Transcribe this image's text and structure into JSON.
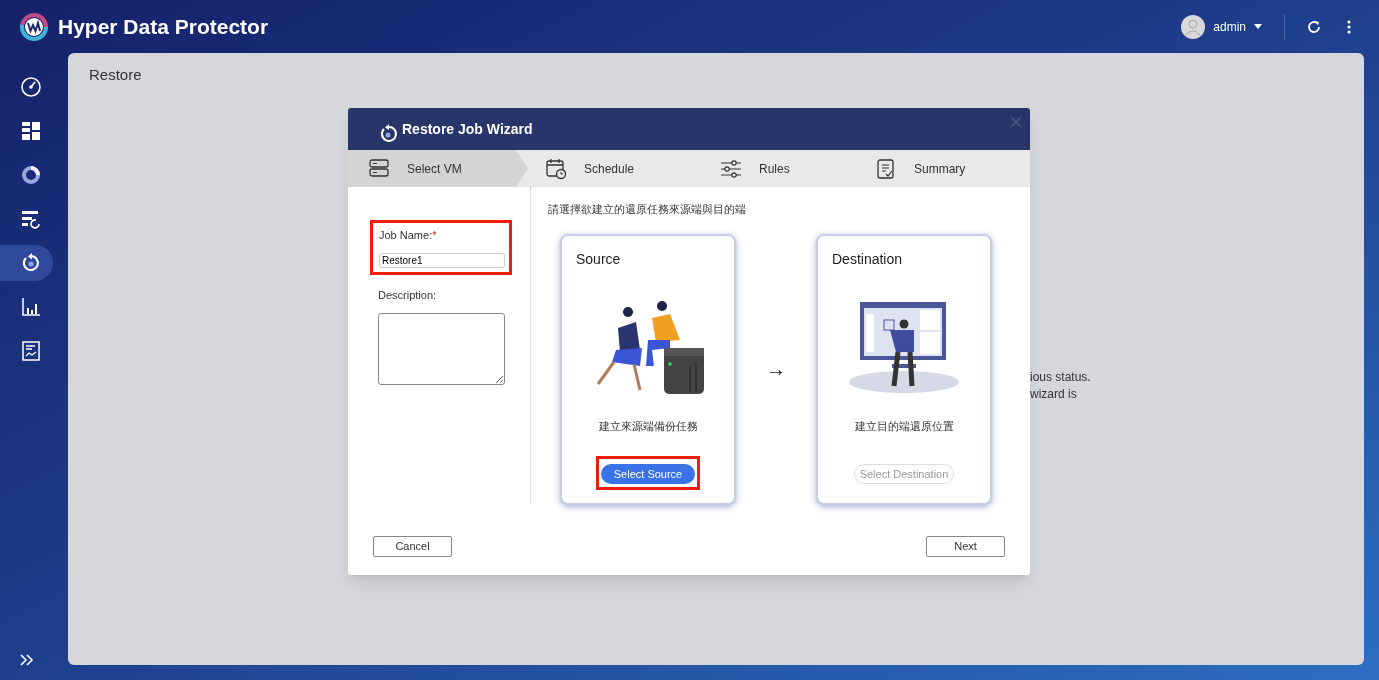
{
  "app": {
    "title": "Hyper Data Protector",
    "user": "admin"
  },
  "sidebar": {
    "items": [
      {
        "kind": "gauge",
        "selected": false
      },
      {
        "kind": "grid",
        "selected": false
      },
      {
        "kind": "donut",
        "selected": false
      },
      {
        "kind": "list-refresh",
        "selected": false
      },
      {
        "kind": "restore",
        "selected": true
      },
      {
        "kind": "chart",
        "selected": false
      },
      {
        "kind": "report",
        "selected": false
      }
    ]
  },
  "page": {
    "title": "Restore",
    "background_text": [
      "ious status.",
      "wizard is"
    ]
  },
  "dialog": {
    "title": "Restore Job Wizard",
    "steps": [
      {
        "kind": "vm",
        "label": "Select VM",
        "selected": true
      },
      {
        "kind": "schedule",
        "label": "Schedule",
        "selected": false
      },
      {
        "kind": "rules",
        "label": "Rules",
        "selected": false
      },
      {
        "kind": "summary",
        "label": "Summary",
        "selected": false
      }
    ],
    "job_name": {
      "label": "Job Name:",
      "required_mark": "*",
      "value": "Restore1",
      "highlighted": true
    },
    "description": {
      "label": "Description:"
    },
    "instruction": "請選擇欲建立的還原任務來源端與目的端",
    "cards": [
      {
        "kind": "source",
        "title": "Source",
        "caption": "建立來源端備份任務",
        "button": "Select Source",
        "disabled": false,
        "highlighted": true
      },
      {
        "kind": "destination",
        "title": "Destination",
        "caption": "建立目的端還原位置",
        "button": "Select Destination",
        "disabled": true,
        "highlighted": false
      }
    ],
    "arrow": "→",
    "buttons": [
      "Cancel",
      "Next"
    ]
  }
}
